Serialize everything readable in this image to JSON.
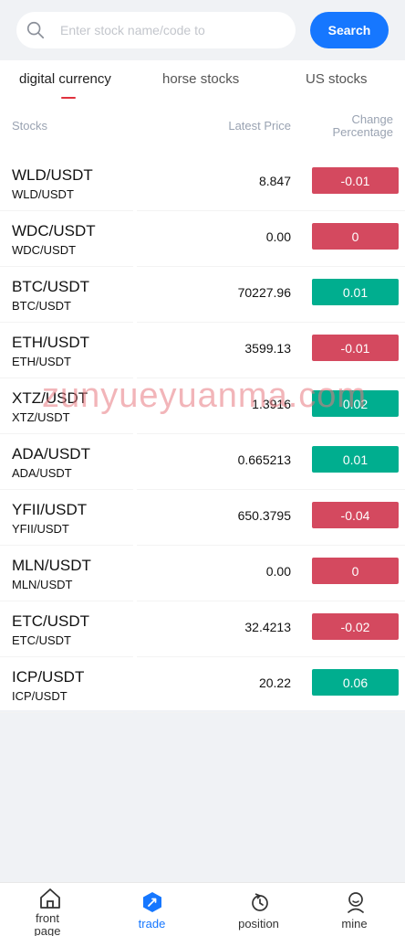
{
  "search": {
    "placeholder": "Enter stock name/code to",
    "button_label": "Search"
  },
  "tabs": [
    {
      "label": "digital currency",
      "active": true
    },
    {
      "label": "horse stocks",
      "active": false
    },
    {
      "label": "US stocks",
      "active": false
    }
  ],
  "columns": {
    "stocks": "Stocks",
    "latest_price": "Latest Price",
    "change_line1": "Change",
    "change_line2": "Percentage"
  },
  "rows": [
    {
      "name": "WLD/USDT",
      "code": "WLD/USDT",
      "price": "8.847",
      "change": "-0.01",
      "direction": "down"
    },
    {
      "name": "WDC/USDT",
      "code": "WDC/USDT",
      "price": "0.00",
      "change": "0",
      "direction": "down"
    },
    {
      "name": "BTC/USDT",
      "code": "BTC/USDT",
      "price": "70227.96",
      "change": "0.01",
      "direction": "up"
    },
    {
      "name": "ETH/USDT",
      "code": "ETH/USDT",
      "price": "3599.13",
      "change": "-0.01",
      "direction": "down"
    },
    {
      "name": "XTZ/USDT",
      "code": "XTZ/USDT",
      "price": "1.3916",
      "change": "0.02",
      "direction": "up"
    },
    {
      "name": "ADA/USDT",
      "code": "ADA/USDT",
      "price": "0.665213",
      "change": "0.01",
      "direction": "up"
    },
    {
      "name": "YFII/USDT",
      "code": "YFII/USDT",
      "price": "650.3795",
      "change": "-0.04",
      "direction": "down"
    },
    {
      "name": "MLN/USDT",
      "code": "MLN/USDT",
      "price": "0.00",
      "change": "0",
      "direction": "down"
    },
    {
      "name": "ETC/USDT",
      "code": "ETC/USDT",
      "price": "32.4213",
      "change": "-0.02",
      "direction": "down"
    },
    {
      "name": "ICP/USDT",
      "code": "ICP/USDT",
      "price": "20.22",
      "change": "0.06",
      "direction": "up"
    }
  ],
  "watermark": "zunyueyuanma.com",
  "nav": {
    "front_page_line1": "front",
    "front_page_line2": "page",
    "trade": "trade",
    "position": "position",
    "mine": "mine",
    "active": "trade"
  },
  "colors": {
    "up": "#00ae8f",
    "down": "#d4495f",
    "accent": "#1677ff",
    "tab_indicator": "#e0323e"
  }
}
